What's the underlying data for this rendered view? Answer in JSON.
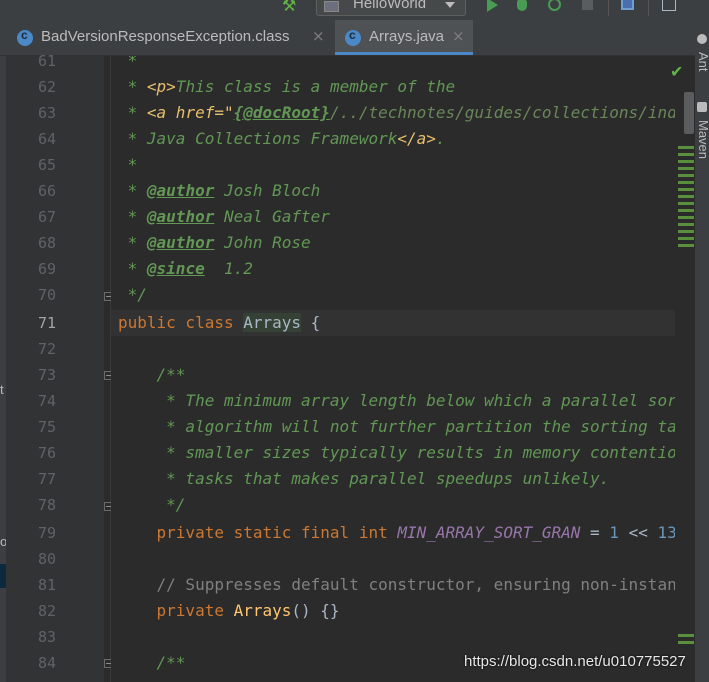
{
  "toolbar": {
    "run_config": "HelloWorld",
    "icons": [
      "hammer-icon",
      "run-icon",
      "debug-icon",
      "coverage-icon",
      "stop-icon",
      "structure-icon",
      "layout-icon"
    ]
  },
  "tabs": [
    {
      "label": "BadVersionResponseException.class",
      "close": "×",
      "active": false
    },
    {
      "label": "Arrays.java",
      "close": "×",
      "active": true
    }
  ],
  "left_strip": {
    "glyph1": "t",
    "glyph2": "o"
  },
  "right_strip": {
    "ant": "Ant",
    "maven": "Maven"
  },
  "editor": {
    "current_line": 71,
    "lines": [
      {
        "n": "61"
      },
      {
        "n": "62"
      },
      {
        "n": "63"
      },
      {
        "n": "64"
      },
      {
        "n": "65"
      },
      {
        "n": "66"
      },
      {
        "n": "67"
      },
      {
        "n": "68"
      },
      {
        "n": "69"
      },
      {
        "n": "70"
      },
      {
        "n": "71"
      },
      {
        "n": "72"
      },
      {
        "n": "73"
      },
      {
        "n": "74"
      },
      {
        "n": "75"
      },
      {
        "n": "76"
      },
      {
        "n": "77"
      },
      {
        "n": "78"
      },
      {
        "n": "79"
      },
      {
        "n": "80"
      },
      {
        "n": "81"
      },
      {
        "n": "82"
      },
      {
        "n": "83"
      },
      {
        "n": "84"
      }
    ],
    "code": {
      "l61": " *",
      "l62_a": " * ",
      "l62_b": "<p>",
      "l62_c": "This class is a member of the",
      "l63_a": " * ",
      "l63_b": "<a href=\"",
      "l63_c": "{@docRoot}",
      "l63_d": "/../technotes/guides/collections/index.html\"",
      "l64_a": " * Java Collections Framework",
      "l64_b": "</a>",
      "l64_c": ".",
      "l65": " *",
      "l66_a": " * ",
      "l66_b": "@author",
      "l66_c": " Josh Bloch",
      "l67_a": " * ",
      "l67_b": "@author",
      "l67_c": " Neal Gafter",
      "l68_a": " * ",
      "l68_b": "@author",
      "l68_c": " John Rose",
      "l69_a": " * ",
      "l69_b": "@since",
      "l69_c": "  1.2",
      "l70": " */",
      "l71_a": "public class ",
      "l71_b": "Arrays",
      "l71_c": " {",
      "l73": "    /**",
      "l74": "     * The minimum array length below which a parallel sorting",
      "l75": "     * algorithm will not further partition the sorting task. Using",
      "l76": "     * smaller sizes typically results in memory contention across",
      "l77": "     * tasks that makes parallel speedups unlikely.",
      "l78": "     */",
      "l79_a": "    private static final int ",
      "l79_b": "MIN_ARRAY_SORT_GRAN",
      "l79_c": " = ",
      "l79_d": "1",
      "l79_e": " << ",
      "l79_f": "13",
      "l81": "    // Suppresses default constructor, ensuring non-instantiability.",
      "l82_a": "    private ",
      "l82_b": "Arrays",
      "l82_c": "() {}",
      "l84": "    /**"
    }
  },
  "watermark": "https://blog.csdn.net/u010775527"
}
